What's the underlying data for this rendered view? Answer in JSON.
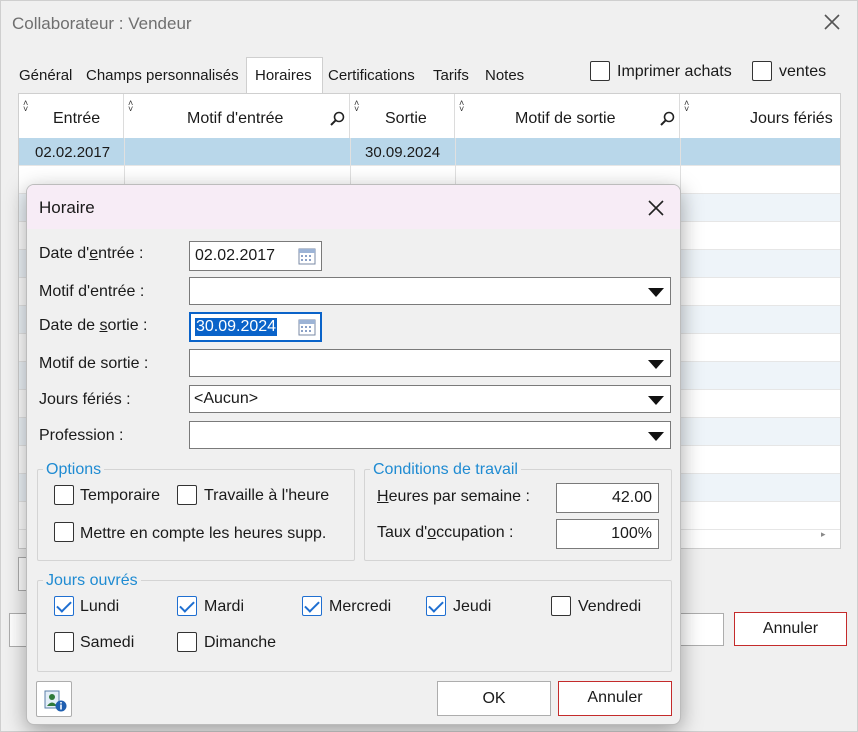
{
  "background_window": {
    "title": "Collaborateur : Vendeur",
    "tabs": [
      {
        "label": "Général"
      },
      {
        "label": "Champs personnalisés"
      },
      {
        "label": "Horaires"
      },
      {
        "label": "Certifications"
      },
      {
        "label": "Tarifs"
      },
      {
        "label": "Notes"
      }
    ],
    "active_tab": "Horaires",
    "print_purchases_label": "Imprimer achats",
    "sales_label": "ventes",
    "grid": {
      "columns": [
        "Entrée",
        "Motif d'entrée",
        "Sortie",
        "Motif de sortie",
        "Jours fériés"
      ],
      "rows": [
        {
          "entree": "02.02.2017",
          "motif_entree": "",
          "sortie": "30.09.2024",
          "motif_sortie": "",
          "jours_feries": ""
        }
      ]
    },
    "cancel_label": "Annuler"
  },
  "dialog": {
    "title": "Horaire",
    "date_entree": {
      "label_pre": "Date d'",
      "label_ul": "e",
      "label_post": "ntrée :",
      "value": "02.02.2017"
    },
    "motif_entree": {
      "label": "Motif d'entrée :",
      "value": ""
    },
    "date_sortie": {
      "label_pre": "Date de ",
      "label_ul": "s",
      "label_post": "ortie :",
      "value": "30.09.2024"
    },
    "motif_sortie": {
      "label": "Motif de sortie :",
      "value": ""
    },
    "jours_feries": {
      "label": "Jours fériés :",
      "value": "<Aucun>"
    },
    "profession": {
      "label": "Profession :",
      "value": ""
    },
    "options": {
      "title": "Options",
      "temporaire": {
        "label": "Temporaire",
        "checked": false
      },
      "travaille_heure": {
        "label": "Travaille à l'heure",
        "checked": false
      },
      "heures_supp": {
        "label": "Mettre en compte les heures supp.",
        "checked": false
      }
    },
    "conditions": {
      "title": "Conditions de travail",
      "heures_label_ul": "H",
      "heures_label_post": "eures par semaine :",
      "heures_value": "42.00",
      "taux_label_pre": "Taux d'",
      "taux_label_ul": "o",
      "taux_label_post": "ccupation :",
      "taux_value": "100%"
    },
    "jours_ouvres": {
      "title": "Jours ouvrés",
      "days": [
        {
          "label": "Lundi",
          "checked": true
        },
        {
          "label": "Mardi",
          "checked": true
        },
        {
          "label": "Mercredi",
          "checked": true
        },
        {
          "label": "Jeudi",
          "checked": true
        },
        {
          "label": "Vendredi",
          "checked": false
        },
        {
          "label": "Samedi",
          "checked": false
        },
        {
          "label": "Dimanche",
          "checked": false
        }
      ]
    },
    "ok_label": "OK",
    "cancel_label": "Annuler"
  },
  "colors": {
    "accent": "#1f8bd2",
    "selection": "#0a63c9",
    "grid_selected_row": "#b9d7ea",
    "cancel_border": "#c42b2b",
    "dialog_titlebar": "#f7ecf6"
  }
}
